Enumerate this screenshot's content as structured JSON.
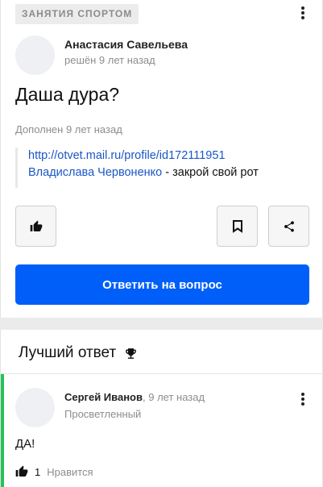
{
  "question": {
    "category": "ЗАНЯТИЯ СПОРТОМ",
    "author": "Анастасия Савельева",
    "status": "решён 9 лет назад",
    "title": "Даша дура?",
    "added": "Дополнен 9 лет назад",
    "quote_link": "http://otvet.mail.ru/profile/id172111951",
    "quote_name": "Владислава Червоненко",
    "quote_text": " - закрой свой рот",
    "reply_label": "Ответить на вопрос"
  },
  "best_answer": {
    "header": "Лучший ответ",
    "author": "Сергей Иванов",
    "separator": ",",
    "time": "9 лет назад",
    "rank": "Просветленный",
    "text": "ДА!",
    "likes_count": "1",
    "likes_label": "Нравится"
  },
  "colors": {
    "accent": "#005ff9",
    "link": "#1a57c7",
    "best": "#26c15a"
  },
  "icons": [
    "more-vert-icon",
    "thumbs-up-icon",
    "bookmark-icon",
    "share-icon",
    "trophy-icon"
  ]
}
